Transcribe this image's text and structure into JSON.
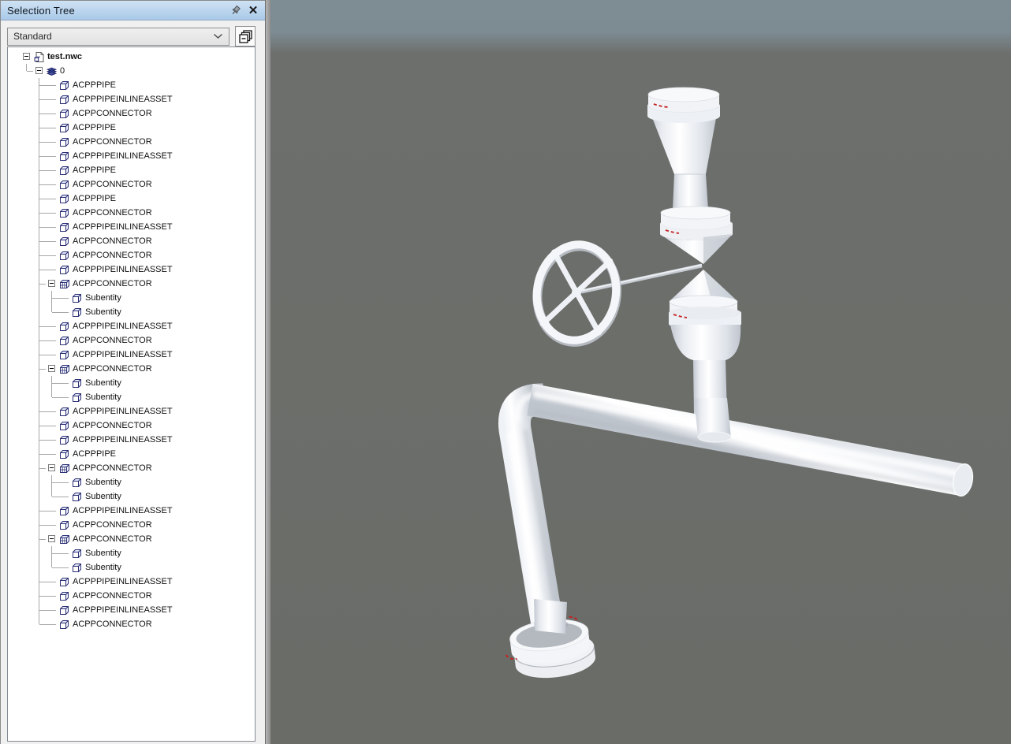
{
  "panel": {
    "title": "Selection Tree",
    "titlebar_icons": [
      "auto-hide-pin-icon",
      "close-icon"
    ],
    "toolbar": {
      "selector_value": "Standard",
      "selector_icon": "chevron-down-icon",
      "stack_button_icon": "cascade-windows-icon"
    }
  },
  "tree": {
    "items": [
      {
        "label": "test.nwc",
        "depth": 0,
        "icon": "file-icon",
        "expanded": true
      },
      {
        "label": "0",
        "depth": 1,
        "icon": "layers-icon",
        "expanded": true
      },
      {
        "label": "ACPPPIPE",
        "depth": 2,
        "icon": "box-icon"
      },
      {
        "label": "ACPPPIPEINLINEASSET",
        "depth": 2,
        "icon": "box-icon"
      },
      {
        "label": "ACPPCONNECTOR",
        "depth": 2,
        "icon": "box-icon"
      },
      {
        "label": "ACPPPIPE",
        "depth": 2,
        "icon": "box-icon"
      },
      {
        "label": "ACPPCONNECTOR",
        "depth": 2,
        "icon": "box-icon"
      },
      {
        "label": "ACPPPIPEINLINEASSET",
        "depth": 2,
        "icon": "box-icon"
      },
      {
        "label": "ACPPPIPE",
        "depth": 2,
        "icon": "box-icon"
      },
      {
        "label": "ACPPCONNECTOR",
        "depth": 2,
        "icon": "box-icon"
      },
      {
        "label": "ACPPPIPE",
        "depth": 2,
        "icon": "box-icon"
      },
      {
        "label": "ACPPCONNECTOR",
        "depth": 2,
        "icon": "box-icon"
      },
      {
        "label": "ACPPPIPEINLINEASSET",
        "depth": 2,
        "icon": "box-icon"
      },
      {
        "label": "ACPPCONNECTOR",
        "depth": 2,
        "icon": "box-icon"
      },
      {
        "label": "ACPPCONNECTOR",
        "depth": 2,
        "icon": "box-icon"
      },
      {
        "label": "ACPPPIPEINLINEASSET",
        "depth": 2,
        "icon": "box-icon"
      },
      {
        "label": "ACPPCONNECTOR",
        "depth": 2,
        "icon": "grid-box-icon",
        "expanded": true
      },
      {
        "label": "Subentity",
        "depth": 3,
        "icon": "box-icon"
      },
      {
        "label": "Subentity",
        "depth": 3,
        "icon": "box-icon"
      },
      {
        "label": "ACPPPIPEINLINEASSET",
        "depth": 2,
        "icon": "box-icon"
      },
      {
        "label": "ACPPCONNECTOR",
        "depth": 2,
        "icon": "box-icon"
      },
      {
        "label": "ACPPPIPEINLINEASSET",
        "depth": 2,
        "icon": "box-icon"
      },
      {
        "label": "ACPPCONNECTOR",
        "depth": 2,
        "icon": "grid-box-icon",
        "expanded": true
      },
      {
        "label": "Subentity",
        "depth": 3,
        "icon": "box-icon"
      },
      {
        "label": "Subentity",
        "depth": 3,
        "icon": "box-icon"
      },
      {
        "label": "ACPPPIPEINLINEASSET",
        "depth": 2,
        "icon": "box-icon"
      },
      {
        "label": "ACPPCONNECTOR",
        "depth": 2,
        "icon": "box-icon"
      },
      {
        "label": "ACPPPIPEINLINEASSET",
        "depth": 2,
        "icon": "box-icon"
      },
      {
        "label": "ACPPPIPE",
        "depth": 2,
        "icon": "box-icon"
      },
      {
        "label": "ACPPCONNECTOR",
        "depth": 2,
        "icon": "grid-box-icon",
        "expanded": true
      },
      {
        "label": "Subentity",
        "depth": 3,
        "icon": "box-icon"
      },
      {
        "label": "Subentity",
        "depth": 3,
        "icon": "box-icon"
      },
      {
        "label": "ACPPPIPEINLINEASSET",
        "depth": 2,
        "icon": "box-icon"
      },
      {
        "label": "ACPPCONNECTOR",
        "depth": 2,
        "icon": "box-icon"
      },
      {
        "label": "ACPPCONNECTOR",
        "depth": 2,
        "icon": "grid-box-icon",
        "expanded": true
      },
      {
        "label": "Subentity",
        "depth": 3,
        "icon": "box-icon"
      },
      {
        "label": "Subentity",
        "depth": 3,
        "icon": "box-icon"
      },
      {
        "label": "ACPPPIPEINLINEASSET",
        "depth": 2,
        "icon": "box-icon"
      },
      {
        "label": "ACPPCONNECTOR",
        "depth": 2,
        "icon": "box-icon"
      },
      {
        "label": "ACPPPIPEINLINEASSET",
        "depth": 2,
        "icon": "box-icon"
      },
      {
        "label": "ACPPCONNECTOR",
        "depth": 2,
        "icon": "box-icon"
      }
    ]
  },
  "viewport": {
    "scene_parts": [
      "top-flange",
      "riser-pipe",
      "globe-valve",
      "handwheel",
      "valve-stem",
      "horizontal-pipe",
      "pipe-elbow",
      "diagonal-pipe",
      "tee-stub",
      "bottom-flange"
    ],
    "colors": {
      "background_top": "#7e8c94",
      "background": "#6b6c68",
      "pipe_white": "#f4f6f9",
      "pipe_shade": "#c2c8d1",
      "marker_red": "#c42222",
      "titlebar_blue": "#aecded",
      "icon_navy": "#2b2f73",
      "guide_gray": "#a8a8a8"
    }
  }
}
